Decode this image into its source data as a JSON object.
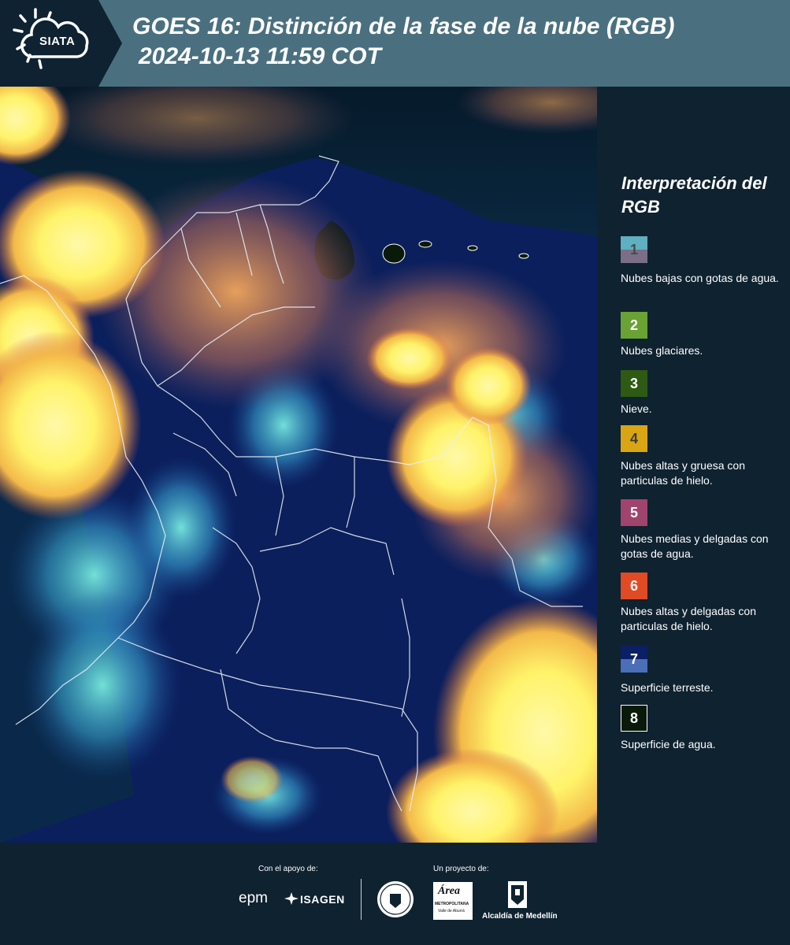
{
  "header": {
    "logo_text": "SIATA",
    "title": "GOES 16: Distinción de la fase de la nube (RGB)",
    "subtitle": "2024-10-13 11:59 COT"
  },
  "legend": {
    "title": "Interpretación del RGB",
    "items": [
      {
        "number": "1",
        "label": "Nubes bajas con gotas de agua.",
        "color_top": "#5fb0c0",
        "color_bottom": "#7b6f88",
        "number_color": "#3a3a3a"
      },
      {
        "number": "2",
        "label": "Nubes glaciares.",
        "color": "#6aa233",
        "number_color": "#ffffff"
      },
      {
        "number": "3",
        "label": "Nieve.",
        "color": "#2e5a14",
        "number_color": "#ffffff"
      },
      {
        "number": "4",
        "label": "Nubes altas y gruesa con particulas de hielo.",
        "color": "#d9a514",
        "number_color": "#3a3a3a"
      },
      {
        "number": "5",
        "label": "Nubes medias y delgadas con gotas de agua.",
        "color": "#a0446e",
        "number_color": "#ffffff"
      },
      {
        "number": "6",
        "label": "Nubes altas y delgadas con particulas de hielo.",
        "color": "#e04a25",
        "number_color": "#ffffff"
      },
      {
        "number": "7",
        "label": "Superficie terreste.",
        "color_top": "#0a1f66",
        "color_bottom": "#4a6fb8",
        "number_color": "#ffffff"
      },
      {
        "number": "8",
        "label": "Superficie de agua.",
        "color": "#0a1a0a",
        "number_color": "#ffffff",
        "border": "#ffffff"
      }
    ]
  },
  "footer": {
    "support_label": "Con el apoyo de:",
    "project_label": "Un proyecto de:",
    "epm": "epm",
    "isagen": "ISAGEN",
    "metropolitana_title": "Área",
    "metropolitana_sub": "METROPOLITANA",
    "metropolitana_sub2": "Valle de Aburrá",
    "alcaldia": "Alcaldía de Medellín"
  }
}
